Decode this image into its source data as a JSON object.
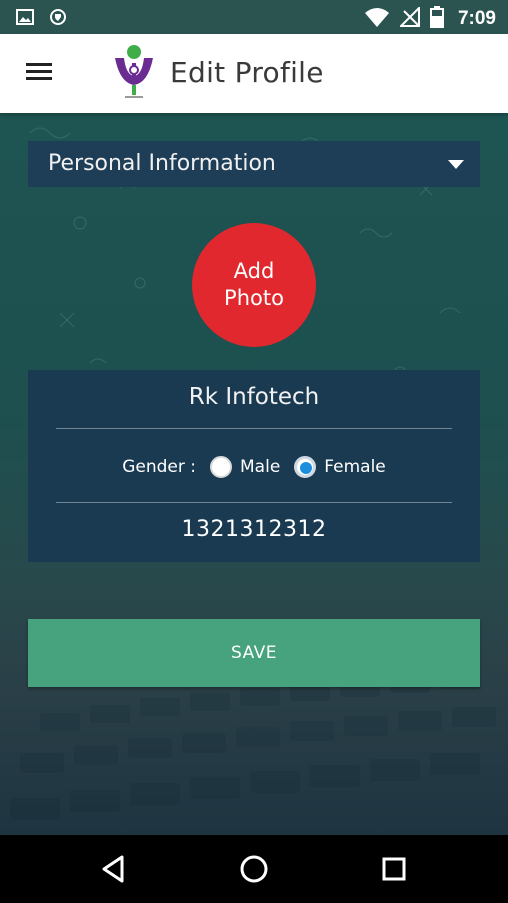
{
  "status_bar": {
    "time": "7:09",
    "icons": [
      "image-icon",
      "shield-icon",
      "wifi-icon",
      "no-signal-icon",
      "battery-icon"
    ]
  },
  "app_bar": {
    "title": "Edit Profile",
    "menu_icon": "menu-icon"
  },
  "section": {
    "selected": "Personal Information"
  },
  "photo": {
    "line1": "Add",
    "line2": "Photo"
  },
  "profile": {
    "name": "Rk Infotech",
    "gender_label": "Gender :",
    "gender_options": [
      "Male",
      "Female"
    ],
    "gender_selected": "Female",
    "phone": "1321312312"
  },
  "actions": {
    "save_label": "SAVE"
  },
  "colors": {
    "accent_red": "#e0282e",
    "save_green": "#46a37d",
    "card_navy": "#1a3a52",
    "radio_blue": "#1a8fe0"
  }
}
